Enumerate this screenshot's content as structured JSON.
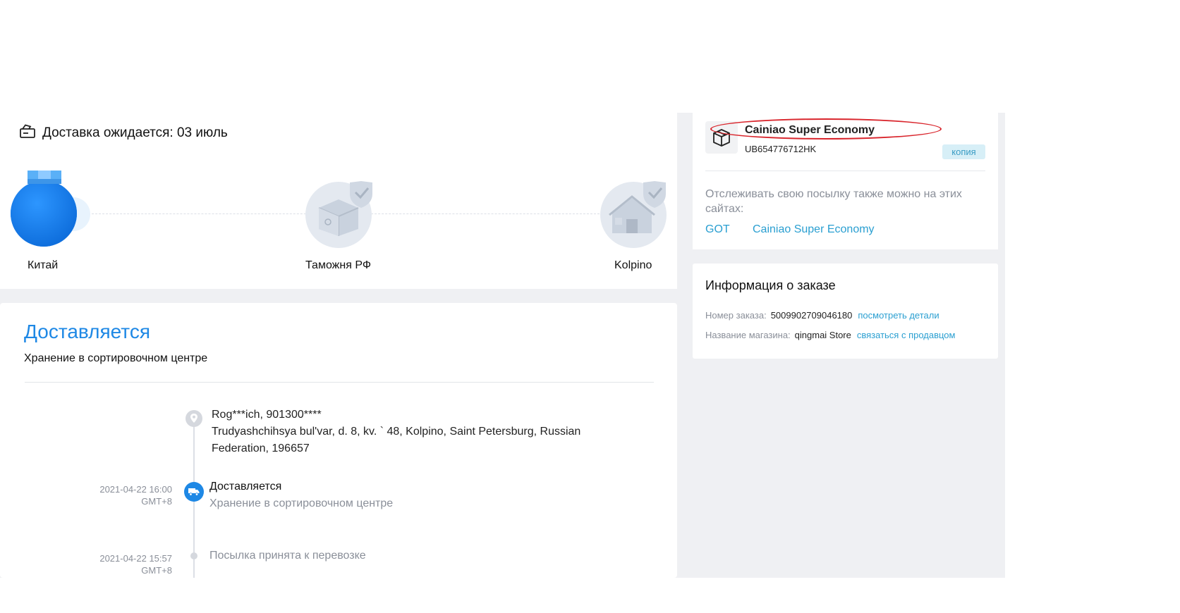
{
  "delivery": {
    "eta_text": "Доставка ожидается: 03 июль"
  },
  "route": {
    "nodes": [
      {
        "label": "Китай",
        "state": "current"
      },
      {
        "label": "Таможня РФ",
        "state": "pending"
      },
      {
        "label": "Kolpino",
        "state": "pending"
      }
    ]
  },
  "status": {
    "title": "Доставляется",
    "subtitle": "Хранение в сортировочном центре"
  },
  "recipient": {
    "name_phone": "Rog***ich,  901300****",
    "address_line1": "Trudyashchihsya bul'var, d. 8, kv. ` 48,  Kolpino,  Saint Petersburg,  Russian",
    "address_line2": "Federation,  196657"
  },
  "events": [
    {
      "date": "2021-04-22 16:00",
      "tz": "GMT+8",
      "title": "Доставляется",
      "description": "Хранение в сортировочном центре",
      "active": true
    },
    {
      "date": "2021-04-22 15:57",
      "tz": "GMT+8",
      "title": "",
      "description": "Посылка принята к перевозке",
      "active": false
    }
  ],
  "carrier": {
    "name": "Cainiao Super Economy",
    "tracking_number": "UB654776712HK",
    "copy_label": "копия",
    "annotation": "red-ellipse-highlight"
  },
  "tracking_sites": {
    "note": "Отслеживать свою посылку также можно на этих сайтах:",
    "links": [
      "GOT",
      "Cainiao Super Economy"
    ]
  },
  "order_info": {
    "title": "Информация о заказе",
    "order_number_label": "Номер заказа:",
    "order_number": "5009902709046180",
    "order_details_link": "посмотреть детали",
    "store_label": "Название магазина:",
    "store_name": "qingmai Store",
    "contact_seller_link": "связаться с продавцом"
  },
  "colors": {
    "accent": "#1e88e5",
    "link": "#2a9fd1",
    "highlight": "#d9252c",
    "page_bg": "#eff0f3"
  },
  "icons": [
    "truck-box-icon",
    "globe-package-icon",
    "customs-box-icon",
    "house-icon",
    "location-pin-icon",
    "delivery-truck-icon",
    "package-icon"
  ]
}
